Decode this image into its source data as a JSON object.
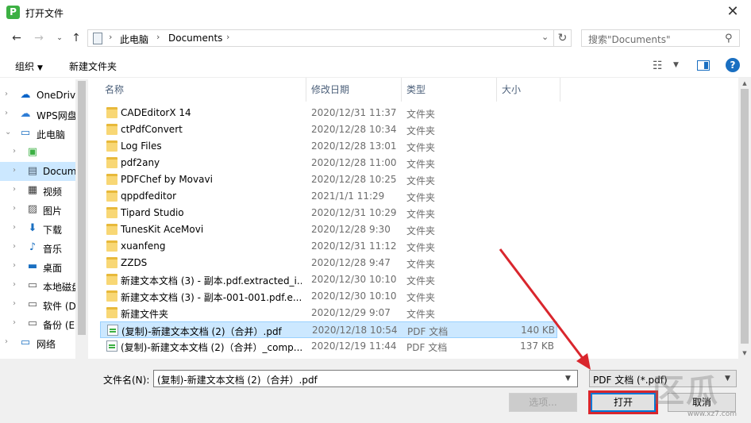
{
  "window": {
    "title": "打开文件",
    "app_icon_letter": "P",
    "close_glyph": "✕"
  },
  "nav": {
    "path_root_glyph": "›",
    "path": [
      "此电脑",
      "Documents"
    ],
    "search_placeholder": "搜索\"Documents\""
  },
  "toolbar": {
    "organize_label": "组织",
    "new_folder_label": "新建文件夹"
  },
  "sidebar": {
    "items": [
      {
        "label": "OneDrive",
        "icon": "☁",
        "color": "#0a64c8",
        "top": true
      },
      {
        "label": "WPS网盘",
        "icon": "☁",
        "color": "#2e7dd6",
        "top": true
      },
      {
        "label": "此电脑",
        "icon": "▭",
        "color": "#1a6fc1",
        "top": true,
        "expanded": true
      },
      {
        "label": "",
        "icon": "▣",
        "color": "#3cb043"
      },
      {
        "label": "Documents",
        "icon": "▤",
        "color": "#4a5a6a",
        "selected": true
      },
      {
        "label": "视频",
        "icon": "▦",
        "color": "#333"
      },
      {
        "label": "图片",
        "icon": "▨",
        "color": "#555"
      },
      {
        "label": "下载",
        "icon": "⬇",
        "color": "#1a6fc1"
      },
      {
        "label": "音乐",
        "icon": "♪",
        "color": "#1a6fc1"
      },
      {
        "label": "桌面",
        "icon": "▬",
        "color": "#1a6fc1"
      },
      {
        "label": "本地磁盘",
        "icon": "▭",
        "color": "#555"
      },
      {
        "label": "软件 (D:)",
        "icon": "▭",
        "color": "#555"
      },
      {
        "label": "备份 (E:)",
        "icon": "▭",
        "color": "#555"
      },
      {
        "label": "网络",
        "icon": "▭",
        "color": "#1a6fc1",
        "top": true
      }
    ]
  },
  "columns": {
    "name": "名称",
    "date": "修改日期",
    "type": "类型",
    "size": "大小"
  },
  "files": [
    {
      "name": "CADEditorX 14",
      "date": "2020/12/31 11:37",
      "type": "文件夹",
      "size": "",
      "kind": "folder"
    },
    {
      "name": "ctPdfConvert",
      "date": "2020/12/28 10:34",
      "type": "文件夹",
      "size": "",
      "kind": "folder"
    },
    {
      "name": "Log Files",
      "date": "2020/12/28 13:01",
      "type": "文件夹",
      "size": "",
      "kind": "folder"
    },
    {
      "name": "pdf2any",
      "date": "2020/12/28 11:00",
      "type": "文件夹",
      "size": "",
      "kind": "folder"
    },
    {
      "name": "PDFChef by Movavi",
      "date": "2020/12/28 10:25",
      "type": "文件夹",
      "size": "",
      "kind": "folder"
    },
    {
      "name": "qppdfeditor",
      "date": "2021/1/1 11:29",
      "type": "文件夹",
      "size": "",
      "kind": "folder"
    },
    {
      "name": "Tipard Studio",
      "date": "2020/12/31 10:29",
      "type": "文件夹",
      "size": "",
      "kind": "folder"
    },
    {
      "name": "TunesKit AceMovi",
      "date": "2020/12/28 9:30",
      "type": "文件夹",
      "size": "",
      "kind": "folder"
    },
    {
      "name": "xuanfeng",
      "date": "2020/12/31 11:12",
      "type": "文件夹",
      "size": "",
      "kind": "folder"
    },
    {
      "name": "ZZDS",
      "date": "2020/12/28 9:47",
      "type": "文件夹",
      "size": "",
      "kind": "folder"
    },
    {
      "name": "新建文本文档 (3) - 副本.pdf.extracted_i...",
      "date": "2020/12/30 10:10",
      "type": "文件夹",
      "size": "",
      "kind": "folder"
    },
    {
      "name": "新建文本文档 (3) - 副本-001-001.pdf.e...",
      "date": "2020/12/30 10:10",
      "type": "文件夹",
      "size": "",
      "kind": "folder"
    },
    {
      "name": "新建文件夹",
      "date": "2020/12/29 9:07",
      "type": "文件夹",
      "size": "",
      "kind": "folder"
    },
    {
      "name": "(复制)-新建文本文档 (2)（合并）.pdf",
      "date": "2020/12/18 10:54",
      "type": "PDF 文档",
      "size": "140 KB",
      "kind": "pdf",
      "selected": true
    },
    {
      "name": "(复制)-新建文本文档 (2)（合并）_comp...",
      "date": "2020/12/19 11:44",
      "type": "PDF 文档",
      "size": "137 KB",
      "kind": "pdf"
    }
  ],
  "footer": {
    "filename_label": "文件名(N):",
    "filename_value": "(复制)-新建文本文档 (2)（合并）.pdf",
    "filter_value": "PDF 文档 (*.pdf)",
    "options_label": "选项...",
    "open_label": "打开",
    "cancel_label": "取消"
  },
  "watermark": {
    "text": "区瓜",
    "sub": "www.xz7.com"
  },
  "colors": {
    "selection": "#cce8ff",
    "highlight_red": "#d9262d",
    "folder": "#f8d775"
  }
}
